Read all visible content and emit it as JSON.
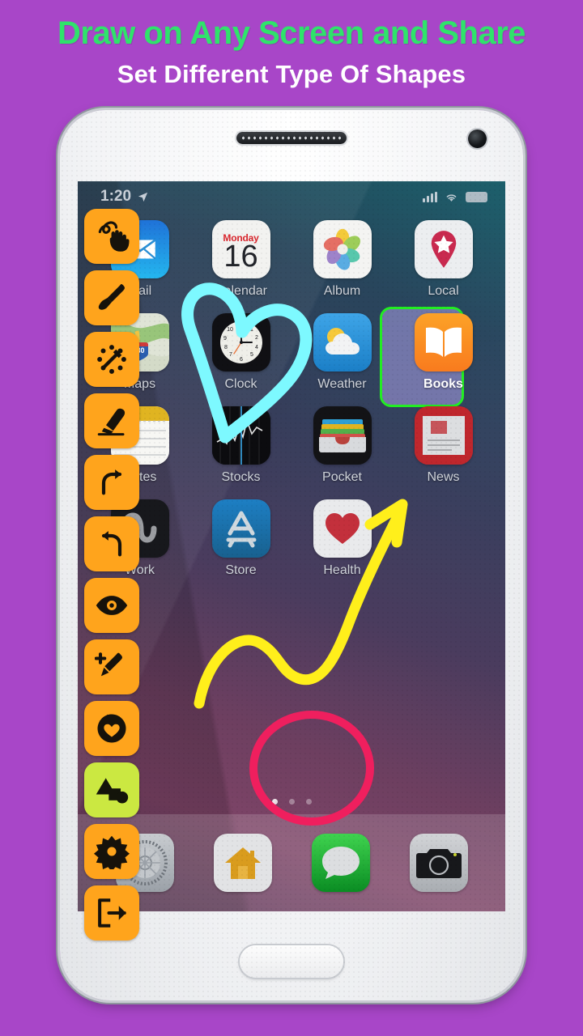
{
  "promo": {
    "title": "Draw on Any Screen and Share",
    "subtitle": "Set Different Type Of Shapes",
    "title_color": "#2fe36b",
    "subtitle_color": "#ffffff",
    "background_color": "#a846c8"
  },
  "toolbar": {
    "items": [
      {
        "name": "hand-draw-icon",
        "label": "Free Draw",
        "color": "#ffa41c",
        "active": false
      },
      {
        "name": "brush-icon",
        "label": "Brush",
        "color": "#ffa41c",
        "active": false
      },
      {
        "name": "magic-wand-icon",
        "label": "Magic Wand",
        "color": "#ffa41c",
        "active": false
      },
      {
        "name": "eraser-icon",
        "label": "Eraser",
        "color": "#ffa41c",
        "active": false
      },
      {
        "name": "redo-icon",
        "label": "Redo",
        "color": "#ffa41c",
        "active": false
      },
      {
        "name": "undo-icon",
        "label": "Undo",
        "color": "#ffa41c",
        "active": false
      },
      {
        "name": "eye-icon",
        "label": "Preview",
        "color": "#ffa41c",
        "active": false
      },
      {
        "name": "add-edit-icon",
        "label": "Add Note",
        "color": "#ffa41c",
        "active": false
      },
      {
        "name": "sticker-heart-icon",
        "label": "Sticker",
        "color": "#ffa41c",
        "active": false
      },
      {
        "name": "shapes-icon",
        "label": "Shapes",
        "color": "#cbe841",
        "active": true
      },
      {
        "name": "gear-icon",
        "label": "Settings",
        "color": "#ffa41c",
        "active": false
      },
      {
        "name": "exit-icon",
        "label": "Exit",
        "color": "#ffa41c",
        "active": false
      }
    ]
  },
  "phone": {
    "status_bar": {
      "time": "1:20",
      "location_icon": "location-arrow-icon",
      "signal_icon": "signal-bars-icon",
      "wifi_icon": "wifi-icon",
      "battery_icon": "battery-icon"
    },
    "home_screen": {
      "apps": [
        {
          "label": "Mail",
          "icon": "mail-icon",
          "selected": false
        },
        {
          "label": "Calendar",
          "icon": "calendar-icon",
          "selected": false,
          "day": "Monday",
          "date": "16"
        },
        {
          "label": "Album",
          "icon": "album-icon",
          "selected": false
        },
        {
          "label": "Local",
          "icon": "local-icon",
          "selected": false
        },
        {
          "label": "Maps",
          "icon": "maps-icon",
          "selected": false,
          "route": "280"
        },
        {
          "label": "Clock",
          "icon": "clock-icon",
          "selected": false
        },
        {
          "label": "Weather",
          "icon": "weather-icon",
          "selected": false
        },
        {
          "label": "Books",
          "icon": "books-icon",
          "selected": true
        },
        {
          "label": "Notes",
          "icon": "notes-icon",
          "selected": false
        },
        {
          "label": "Stocks",
          "icon": "stocks-icon",
          "selected": false
        },
        {
          "label": "Pocket",
          "icon": "pocket-icon",
          "selected": false
        },
        {
          "label": "News",
          "icon": "news-icon",
          "selected": false
        },
        {
          "label": "Work",
          "icon": "work-icon",
          "selected": false
        },
        {
          "label": "Store",
          "icon": "store-icon",
          "selected": false
        },
        {
          "label": "Health",
          "icon": "health-icon",
          "selected": false
        },
        {
          "label": "",
          "icon": "empty-slot",
          "selected": false
        }
      ],
      "page_dots": {
        "count": 3,
        "active_index": 0
      },
      "dock": [
        {
          "label": "Settings",
          "icon": "settings-icon"
        },
        {
          "label": "Home",
          "icon": "home-icon"
        },
        {
          "label": "Messages",
          "icon": "messages-icon"
        },
        {
          "label": "Camera",
          "icon": "camera-icon"
        }
      ]
    },
    "hardware": {
      "speaker": "speaker-grille",
      "front_camera": "front-camera",
      "home_button": "home-button"
    }
  },
  "annotations": [
    {
      "name": "heart-shape",
      "shape": "heart",
      "color": "#7df9ff"
    },
    {
      "name": "arrow-shape",
      "shape": "arrow",
      "color": "#ffef1b"
    },
    {
      "name": "circle-shape",
      "shape": "circle",
      "color": "#ef1f5e"
    },
    {
      "name": "selection-highlight",
      "shape": "rect",
      "color": "#22ee22"
    }
  ]
}
